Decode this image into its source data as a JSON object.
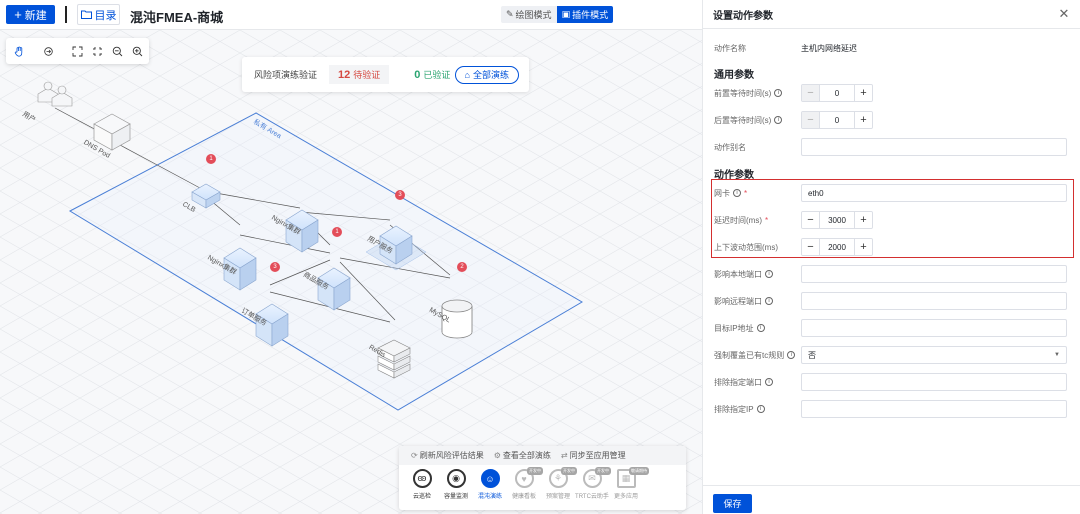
{
  "topbar": {
    "new_label": "新建",
    "catalog_label": "目录",
    "title": "混沌FMEA-商城",
    "draw_mode": "绘图模式",
    "plugin_mode": "插件模式"
  },
  "risk": {
    "label": "风险项演练验证",
    "pending_count": "12",
    "pending_label": "待验证",
    "verified_count": "0",
    "verified_label": "已验证",
    "all_btn": "全部演练"
  },
  "diagram": {
    "nodes": {
      "user": "用户",
      "dns": "DNS Pod",
      "vpc": "私有 Area",
      "clb": "CLB",
      "nginx1": "Nginx集群",
      "nginx2": "Nginx集群",
      "user_service": "用户服务",
      "product_service": "商品服务",
      "order_service": "订单服务",
      "mysql": "MySQL",
      "redis": "Redis"
    },
    "badges": {
      "clb": "1",
      "user_service": "3",
      "product_service": "1",
      "order_service": "3",
      "mysql": "2"
    }
  },
  "bottom": {
    "actions": [
      "刷新风险评估结果",
      "查看全部演练",
      "同步至应用管理"
    ],
    "apps": [
      {
        "name": "云巡检",
        "tag": ""
      },
      {
        "name": "容量监测",
        "tag": ""
      },
      {
        "name": "混沌演练",
        "tag": ""
      },
      {
        "name": "健康看板",
        "tag": "开发中"
      },
      {
        "name": "预案管理",
        "tag": "开发中"
      },
      {
        "name": "TRTC云助手",
        "tag": "开发中"
      },
      {
        "name": "更多应用",
        "tag": "敬请期待"
      }
    ]
  },
  "panel": {
    "title": "设置动作参数",
    "action_name_label": "动作名称",
    "action_name_value": "主机内网络延迟",
    "general_section": "通用参数",
    "pre_wait_label": "前置等待时间(s)",
    "pre_wait_value": "0",
    "post_wait_label": "后置等待时间(s)",
    "post_wait_value": "0",
    "alias_label": "动作别名",
    "alias_value": "",
    "action_section": "动作参数",
    "nic_label": "网卡",
    "nic_value": "eth0",
    "delay_label": "延迟时间(ms)",
    "delay_value": "3000",
    "jitter_label": "上下波动范围(ms)",
    "jitter_value": "2000",
    "local_port_label": "影响本地端口",
    "remote_port_label": "影响远程端口",
    "target_ip_label": "目标IP地址",
    "force_tc_label": "强制覆盖已有tc规则",
    "force_tc_value": "否",
    "exclude_port_label": "排除指定端口",
    "exclude_ip_label": "排除指定IP",
    "save_label": "保存"
  },
  "colors": {
    "primary": "#0052d9",
    "danger": "#e34d59",
    "success": "#2ba471",
    "highlight_box": "#d32f2f"
  }
}
